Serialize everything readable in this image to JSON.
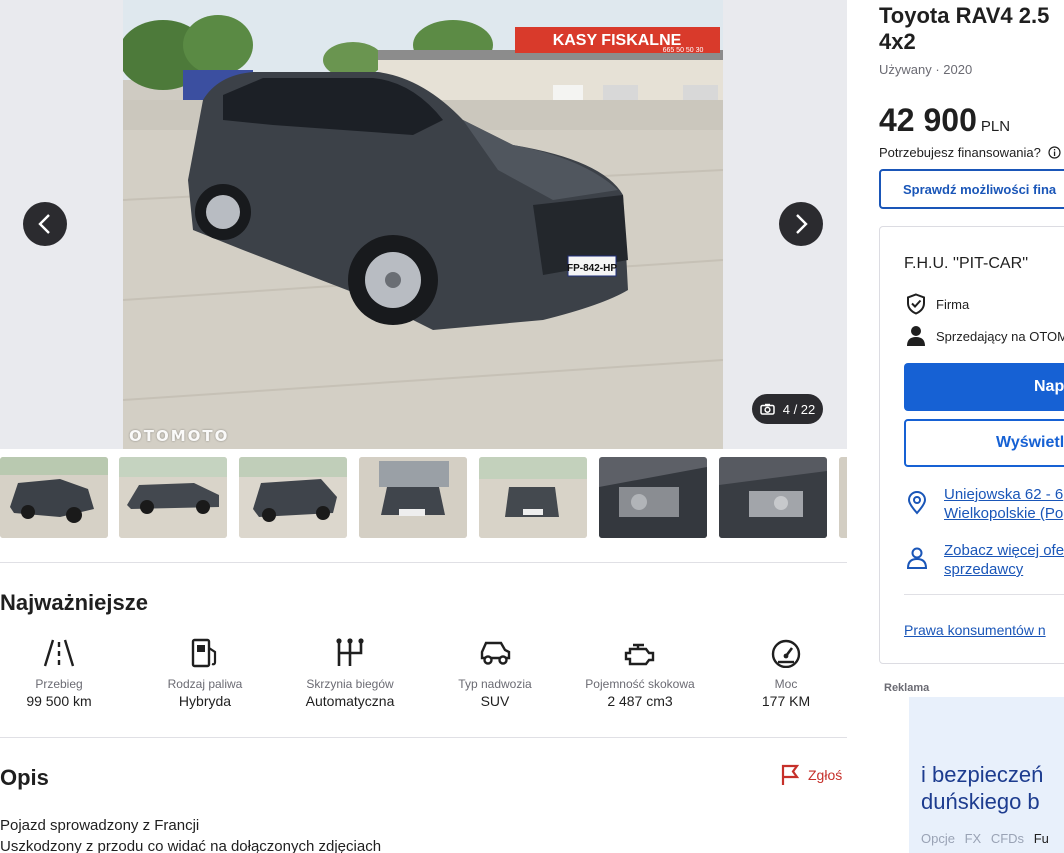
{
  "gallery": {
    "watermark": "OTOMOTO",
    "counter": "4 / 22",
    "plate": "FP-842-HP",
    "sign_text": "KASY FISKALNE",
    "sign_phone": "665 50 50 30"
  },
  "listing": {
    "title_line1": "Toyota RAV4 2.5",
    "title_line2": "4x2",
    "meta": "Używany · 2020",
    "price": "42 900",
    "currency": "PLN",
    "finance_question": "Potrzebujesz finansowania?",
    "finance_button": "Sprawdź możliwości fina"
  },
  "highlights": {
    "title": "Najważniejsze",
    "items": [
      {
        "label": "Przebieg",
        "value": "99 500 km",
        "icon": "road-icon"
      },
      {
        "label": "Rodzaj paliwa",
        "value": "Hybryda",
        "icon": "fuel-pump-icon"
      },
      {
        "label": "Skrzynia biegów",
        "value": "Automatyczna",
        "icon": "gearbox-icon"
      },
      {
        "label": "Typ nadwozia",
        "value": "SUV",
        "icon": "car-body-icon"
      },
      {
        "label": "Pojemność skokowa",
        "value": "2 487 cm3",
        "icon": "engine-icon"
      },
      {
        "label": "Moc",
        "value": "177 KM",
        "icon": "speedometer-icon"
      }
    ]
  },
  "description": {
    "title": "Opis",
    "report": "Zgłoś",
    "line1": "Pojazd sprowadzony z Francji",
    "line2": "Uszkodzony z przodu co widać na dołączonych zdjęciach"
  },
  "seller": {
    "name": "F.H.U. ''PIT-CAR''",
    "type": "Firma",
    "since": "Sprzedający na OTOM",
    "primary_button": "Nap",
    "secondary_button": "Wyświetl",
    "address_line1": "Uniejowska 62 - 6",
    "address_line2": "Wielkopolskie (Po",
    "more_line1": "Zobacz więcej ofe",
    "more_line2": "sprzedawcy",
    "consumer_rights": "Prawa konsumentów n"
  },
  "ad": {
    "label": "Reklama",
    "line1": "i bezpieczeń",
    "line2": "duńskiego b",
    "tabs": [
      "Opcje",
      "FX",
      "CFDs",
      "Fu"
    ]
  },
  "colors": {
    "accent": "#1661d4",
    "link": "#1a56b8",
    "report": "#c6302a",
    "car": "#3c4148"
  }
}
